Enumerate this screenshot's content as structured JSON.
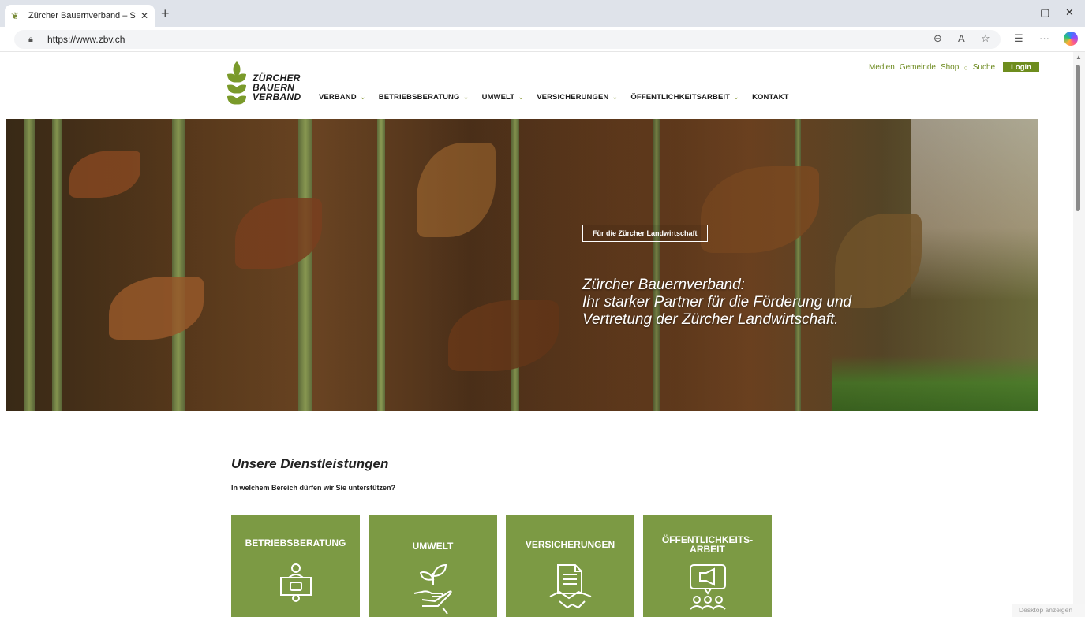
{
  "browser": {
    "tab_title": "Zürcher Bauernverband – Startsei",
    "tab_close": "✕",
    "new_tab": "+",
    "url": "https://www.zbv.ch",
    "window_controls": [
      "–",
      "▢",
      "✕"
    ],
    "toolbar_icons": [
      "zoom-icon",
      "read-aloud-icon",
      "favorite-star-icon",
      "favorites-list-icon",
      "more-menu-icon",
      "copilot-icon"
    ],
    "toolbar_glyphs": [
      "⊖",
      "A",
      "☆",
      "☰",
      "···"
    ]
  },
  "site": {
    "logo": {
      "line1": "ZÜRCHER",
      "line2": "BAUERN",
      "line3": "VERBAND",
      "color": "#7a9a2a"
    },
    "nav": [
      {
        "label": "VERBAND",
        "dropdown": true
      },
      {
        "label": "BETRIEBSBERATUNG",
        "dropdown": true
      },
      {
        "label": "UMWELT",
        "dropdown": true
      },
      {
        "label": "VERSICHERUNGEN",
        "dropdown": true
      },
      {
        "label": "ÖFFENTLICHKEITSARBEIT",
        "dropdown": true
      },
      {
        "label": "KONTAKT",
        "dropdown": false
      }
    ],
    "utility": {
      "medien": "Medien",
      "gemeinde": "Gemeinde",
      "shop": "Shop",
      "suche": "Suche",
      "login": "Login"
    },
    "accent": "#6e8d1e"
  },
  "hero": {
    "badge": "Für die Zürcher Landwirtschaft",
    "line1": "Zürcher Bauernverband:",
    "line2": "Ihr starker Partner für die Förderung und",
    "line3": "Vertretung der Zürcher Landwirtschaft."
  },
  "services": {
    "title": "Unsere Dienstleistungen",
    "subtitle": "In welchem Bereich dürfen wir Sie unterstützen?",
    "card_color": "#7c9a44",
    "cards": [
      {
        "line1": "BETRIEBSBERATUNG",
        "line2": "",
        "icon": "consulting-icon"
      },
      {
        "line1": "UMWELT",
        "line2": "",
        "icon": "plant-hand-icon"
      },
      {
        "line1": "VERSICHERUNGEN",
        "line2": "",
        "icon": "contract-handshake-icon"
      },
      {
        "line1": "ÖFFENTLICHKEITS-",
        "line2": "ARBEIT",
        "icon": "megaphone-audience-icon"
      }
    ]
  },
  "desktop_hint": "Desktop anzeigen"
}
